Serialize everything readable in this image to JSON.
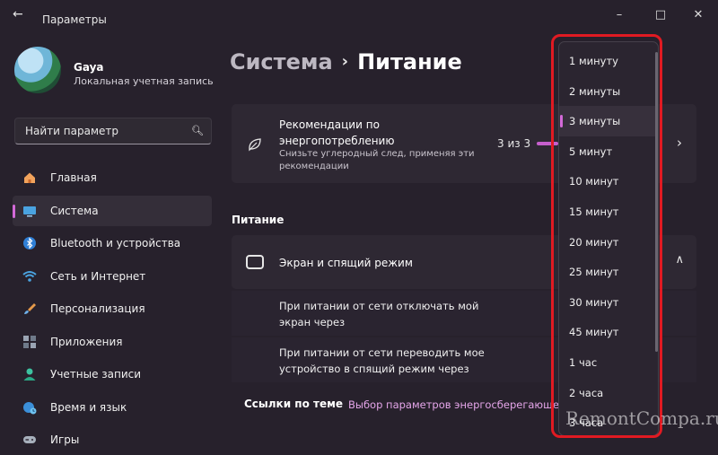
{
  "window": {
    "title": "Параметры",
    "back_icon": "back-arrow-icon",
    "controls": [
      "minimize-icon",
      "maximize-icon",
      "close-icon"
    ]
  },
  "user": {
    "name": "Gaya",
    "account_type": "Локальная учетная запись"
  },
  "search": {
    "placeholder": "Найти параметр",
    "icon": "search-icon"
  },
  "sidebar": {
    "items": [
      {
        "label": "Главная",
        "icon": "home-icon",
        "active": false
      },
      {
        "label": "Система",
        "icon": "system-icon",
        "active": true
      },
      {
        "label": "Bluetooth и устройства",
        "icon": "bluetooth-icon",
        "active": false
      },
      {
        "label": "Сеть и Интернет",
        "icon": "wifi-icon",
        "active": false
      },
      {
        "label": "Персонализация",
        "icon": "brush-icon",
        "active": false
      },
      {
        "label": "Приложения",
        "icon": "apps-icon",
        "active": false
      },
      {
        "label": "Учетные записи",
        "icon": "accounts-icon",
        "active": false
      },
      {
        "label": "Время и язык",
        "icon": "globe-clock-icon",
        "active": false
      },
      {
        "label": "Игры",
        "icon": "gamepad-icon",
        "active": false
      }
    ]
  },
  "breadcrumb": {
    "parent": "Система",
    "separator": "›",
    "current": "Питание"
  },
  "recommendations": {
    "title": "Рекомендации по энергопотреблению",
    "subtitle": "Снизьте углеродный след, применяя эти рекомендации",
    "count": "3 из 3",
    "progress": 1.0,
    "icon": "leaf-icon"
  },
  "power_section": {
    "label": "Питание",
    "screen_sleep": {
      "title": "Экран и спящий режим",
      "icon": "screen-sleep-icon",
      "expanded": true
    },
    "rows": [
      {
        "text": "При питании от сети отключать мой экран через"
      },
      {
        "text": "При питании от сети переводить мое устройство в спящий режим через"
      }
    ]
  },
  "related_links": {
    "label": "Ссылки по теме",
    "link": "Выбор параметров энергосберегающе"
  },
  "dropdown": {
    "options": [
      "1 минуту",
      "2 минуты",
      "3 минуты",
      "5 минут",
      "10 минут",
      "15 минут",
      "20 минут",
      "25 минут",
      "30 минут",
      "45 минут",
      "1 час",
      "2 часа",
      "3 часа"
    ],
    "selected_index": 2
  },
  "colors": {
    "accent": "#d36ad8",
    "background": "#27212c",
    "card": "#2e2833",
    "highlight_frame": "#e01a22"
  },
  "watermark": "RemontCompa.ru"
}
